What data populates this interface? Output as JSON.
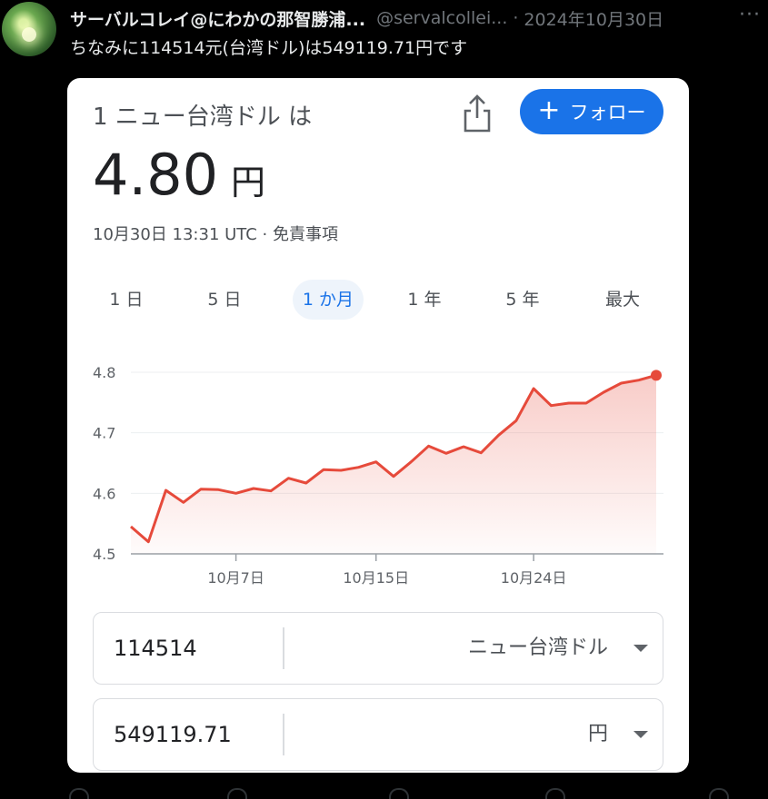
{
  "tweet": {
    "author_name": "サーバルコレイ@にわかの那智勝浦...",
    "handle": "@servalcollei...",
    "separator": "·",
    "date": "2024年10月30日",
    "more": "···",
    "text": "ちなみに114514元(台湾ドル)は549119.71円です"
  },
  "card": {
    "title": "1 ニュー台湾ドル は",
    "follow_label": "フォロー",
    "value": "4.80",
    "unit": "円",
    "meta": "10月30日 13:31 UTC · 免責事項",
    "tabs": [
      "1 日",
      "5 日",
      "1 か月",
      "1 年",
      "5 年",
      "最大"
    ],
    "active_tab": "1 か月",
    "converter": {
      "from_amount": "114514",
      "from_currency": "ニュー台湾ドル",
      "to_amount": "549119.71",
      "to_currency": "円"
    }
  },
  "colors": {
    "line": "#e64a3b",
    "accent": "#1a73e8"
  },
  "chart_data": {
    "type": "area",
    "ylim": [
      4.5,
      4.8
    ],
    "yticks": [
      "4.5",
      "4.6",
      "4.7",
      "4.8"
    ],
    "xticks": [
      {
        "label": "10月7日",
        "day": 7
      },
      {
        "label": "10月15日",
        "day": 15
      },
      {
        "label": "10月24日",
        "day": 24
      }
    ],
    "x_day_range": [
      1,
      31
    ],
    "series": [
      {
        "x": [
          1,
          2,
          3,
          4,
          5,
          6,
          7,
          8,
          9,
          10,
          11,
          12,
          13,
          14,
          15,
          16,
          17,
          18,
          19,
          20,
          21,
          22,
          23,
          24,
          25,
          26,
          27,
          28,
          29,
          30,
          31
        ],
        "values": [
          4.545,
          4.52,
          4.605,
          4.585,
          4.607,
          4.606,
          4.6,
          4.608,
          4.604,
          4.625,
          4.617,
          4.639,
          4.638,
          4.643,
          4.652,
          4.628,
          4.652,
          4.678,
          4.666,
          4.677,
          4.667,
          4.696,
          4.72,
          4.773,
          4.745,
          4.749,
          4.749,
          4.767,
          4.782,
          4.787,
          4.795
        ]
      }
    ]
  }
}
